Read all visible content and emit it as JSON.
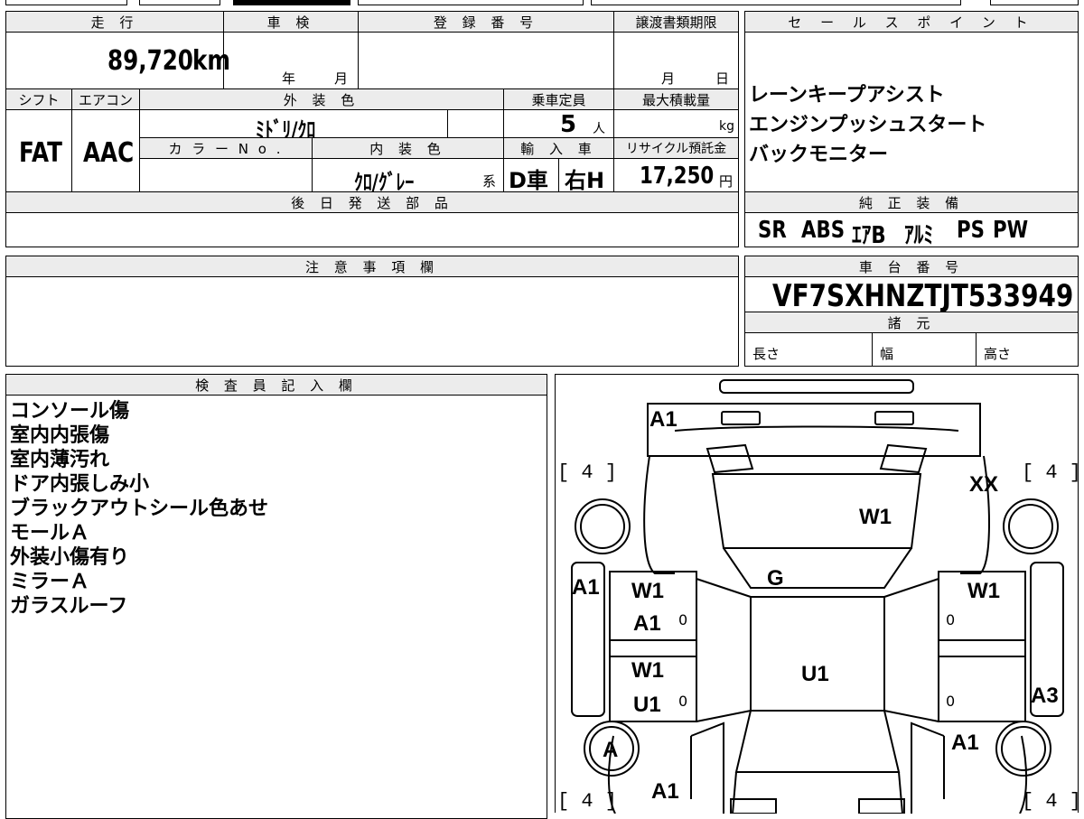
{
  "top": {
    "mileage_label": "走 行",
    "mileage_value": "89,720",
    "mileage_unit": "km",
    "inspection_label": "車 検",
    "inspection_year_unit": "年",
    "inspection_month_unit": "月",
    "registration_label": "登 録 番 号",
    "transfer_label": "譲渡書類期限",
    "transfer_month_unit": "月",
    "transfer_day_unit": "日",
    "shift_label": "シフト",
    "aircon_label": "エアコン",
    "exterior_label": "外 装 色",
    "capacity_label": "乗車定員",
    "load_label": "最大積載量",
    "shift_value": "FAT",
    "aircon_value": "AAC",
    "exterior_value": "ﾐﾄﾞﾘ/ｸﾛ",
    "capacity_value": "5",
    "capacity_unit": "人",
    "load_unit": "kg",
    "color_no_label": "カ ラ ー N o .",
    "interior_label": "内 装 色",
    "import_label": "輸 入 車",
    "recycle_label": "リサイクル預託金",
    "interior_value": "ｸﾛ/ｸﾞﾚｰ",
    "interior_suffix": "系",
    "import_value": "D車",
    "handle_value": "右H",
    "recycle_value": "17,250",
    "recycle_unit": "円",
    "later_label": "後 日 発 送 部 品"
  },
  "sales": {
    "label": "セ ー ル ス ポ イ ン ト",
    "lines": [
      "レーンキープアシスト",
      "エンジンプッシュスタート",
      "バックモニター"
    ]
  },
  "equipment": {
    "label": "純 正 装 備",
    "items": [
      "SR",
      "ABS",
      "ｴｱB",
      "ｱﾙﾐ",
      "PS",
      "PW"
    ]
  },
  "notes": {
    "label": "注 意 事 項 欄"
  },
  "chassis": {
    "label": "車 台 番 号",
    "value": "VF7SXHNZTJT533949",
    "spec_label": "諸 元",
    "length_label": "長さ",
    "width_label": "幅",
    "height_label": "高さ"
  },
  "inspector": {
    "label": "検 査 員 記 入 欄",
    "lines": [
      "コンソール傷",
      "室内内張傷",
      "室内薄汚れ",
      "ドア内張しみ小",
      "ブラックアウトシール色あせ",
      "モールＡ",
      "外装小傷有り",
      "ミラーＡ",
      "ガラスルーフ"
    ]
  },
  "diagram": {
    "tire_fl": "[ 4 ]",
    "tire_fr": "[ 4 ]",
    "tire_rl": "[ 4 ]",
    "tire_rr": "[ 4 ]",
    "front_bumper": "A1",
    "front_right_corner": "XX",
    "windshield": "W1",
    "hood": "G",
    "roof": "U1",
    "left_fender": "A1",
    "front_left_window": "W1",
    "front_left_door": "A1",
    "rear_left_window": "W1",
    "rear_left_door": "U1",
    "front_right_window": "W1",
    "right_quarter": "A3",
    "rear_right": "A1",
    "rear_left_wheel": "A",
    "rear_bumper": "A1",
    "zero_fl": "0",
    "zero_rl": "0",
    "zero_fr": "0",
    "zero_rr": "0"
  }
}
